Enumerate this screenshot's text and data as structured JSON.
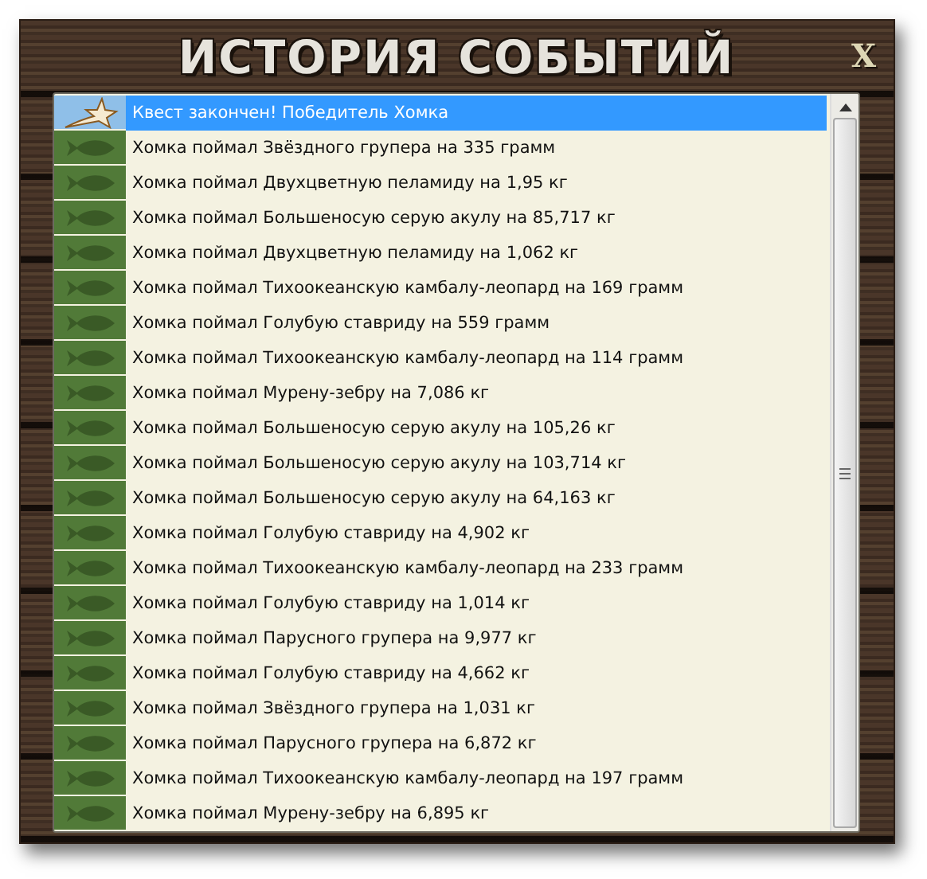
{
  "window": {
    "title": "ИСТОРИЯ СОБЫТИЙ",
    "close": "X"
  },
  "events": [
    {
      "kind": "quest",
      "text": "Квест закончен! Победитель Хомка",
      "selected": true
    },
    {
      "kind": "catch",
      "text": "Хомка поймал Звёздного групера на 335 грамм",
      "selected": false
    },
    {
      "kind": "catch",
      "text": "Хомка поймал Двухцветную пеламиду на 1,95 кг",
      "selected": false
    },
    {
      "kind": "catch",
      "text": "Хомка поймал Большеносую серую акулу на 85,717 кг",
      "selected": false
    },
    {
      "kind": "catch",
      "text": "Хомка поймал Двухцветную пеламиду на 1,062 кг",
      "selected": false
    },
    {
      "kind": "catch",
      "text": "Хомка поймал Тихоокеанскую камбалу-леопард на 169 грамм",
      "selected": false
    },
    {
      "kind": "catch",
      "text": "Хомка поймал Голубую ставриду на 559 грамм",
      "selected": false
    },
    {
      "kind": "catch",
      "text": "Хомка поймал Тихоокеанскую камбалу-леопард на 114 грамм",
      "selected": false
    },
    {
      "kind": "catch",
      "text": "Хомка поймал Мурену-зебру на 7,086 кг",
      "selected": false
    },
    {
      "kind": "catch",
      "text": "Хомка поймал Большеносую серую акулу на 105,26 кг",
      "selected": false
    },
    {
      "kind": "catch",
      "text": "Хомка поймал Большеносую серую акулу на 103,714 кг",
      "selected": false
    },
    {
      "kind": "catch",
      "text": "Хомка поймал Большеносую серую акулу на 64,163 кг",
      "selected": false
    },
    {
      "kind": "catch",
      "text": "Хомка поймал Голубую ставриду на 4,902 кг",
      "selected": false
    },
    {
      "kind": "catch",
      "text": "Хомка поймал Тихоокеанскую камбалу-леопард на 233 грамм",
      "selected": false
    },
    {
      "kind": "catch",
      "text": "Хомка поймал Голубую ставриду на 1,014 кг",
      "selected": false
    },
    {
      "kind": "catch",
      "text": "Хомка поймал Парусного групера на 9,977 кг",
      "selected": false
    },
    {
      "kind": "catch",
      "text": "Хомка поймал Голубую ставриду на 4,662 кг",
      "selected": false
    },
    {
      "kind": "catch",
      "text": "Хомка поймал Звёздного групера на 1,031 кг",
      "selected": false
    },
    {
      "kind": "catch",
      "text": "Хомка поймал Парусного групера на 6,872 кг",
      "selected": false
    },
    {
      "kind": "catch",
      "text": "Хомка поймал Тихоокеанскую камбалу-леопард на 197 грамм",
      "selected": false
    },
    {
      "kind": "catch",
      "text": "Хомка поймал Мурену-зебру на 6,895 кг",
      "selected": false
    }
  ]
}
